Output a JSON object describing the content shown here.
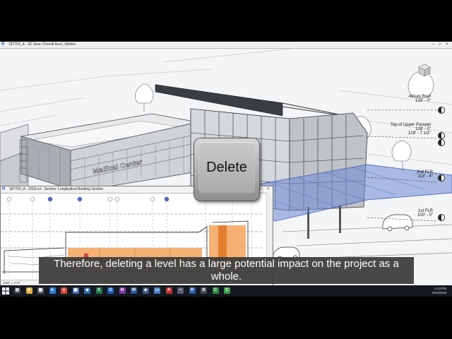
{
  "main_window": {
    "title": "187703_A - 3D View: Overall Asen_Hidden",
    "app_badge": "R",
    "controls": [
      "–",
      "□",
      "×"
    ]
  },
  "building": {
    "sign_text": "Medical Center"
  },
  "levels": [
    {
      "name": "Atrium Roof",
      "elev": "135' - 0\""
    },
    {
      "name": "Top of Upper Parapet",
      "elev": "128' - 0\"",
      "elev2": "128' - 7 1/2\""
    },
    {
      "name": "2nd FLR",
      "elev": "113' - 4\""
    },
    {
      "name": "1st FLR",
      "elev": "100' - 0\""
    }
  ],
  "section_window": {
    "title": "187703_A - 2019.rvt - Section: Longitudinal Building Section",
    "app_badge": "R",
    "controls": [
      "–",
      "□",
      "×"
    ],
    "scale": "1/16\" = 1'-0\""
  },
  "key_overlay": {
    "label": "Delete"
  },
  "caption": {
    "text": "Therefore, deleting a level has a large potential impact on the project as a whole."
  },
  "taskbar": {
    "time": "4:13 PM",
    "date": "2/16/2018",
    "apps": [
      {
        "name": "task-view",
        "color": "#3a3f4a",
        "glyph": "▤"
      },
      {
        "name": "file-explorer",
        "color": "#e0b040",
        "glyph": "■"
      },
      {
        "name": "calculator",
        "color": "#555b66",
        "glyph": "▦"
      },
      {
        "name": "edge",
        "color": "#2f7bd3",
        "glyph": "e"
      },
      {
        "name": "chrome",
        "color": "#d84b3a",
        "glyph": "●"
      },
      {
        "name": "store",
        "color": "#4a6fb0",
        "glyph": "▣"
      },
      {
        "name": "autodesk",
        "color": "#2d6aa8",
        "glyph": "◆"
      },
      {
        "name": "excel",
        "color": "#1f7a44",
        "glyph": "X"
      },
      {
        "name": "outlook",
        "color": "#1a5fb4",
        "glyph": "O"
      },
      {
        "name": "onenote",
        "color": "#7b3aa0",
        "glyph": "N"
      },
      {
        "name": "word",
        "color": "#2b5797",
        "glyph": "W"
      },
      {
        "name": "settings",
        "color": "#3a5a8a",
        "glyph": "◈"
      },
      {
        "name": "navisworks",
        "color": "#4a7fc0",
        "glyph": "▭"
      },
      {
        "name": "acrobat",
        "color": "#c0302a",
        "glyph": "A"
      },
      {
        "name": "people",
        "color": "#5a6070",
        "glyph": "•"
      },
      {
        "name": "revit",
        "color": "#2a5ca8",
        "glyph": "R"
      },
      {
        "name": "gear",
        "color": "#444a55",
        "glyph": "⚙"
      },
      {
        "name": "camtasia",
        "color": "#2f8a3e",
        "glyph": "C"
      },
      {
        "name": "camtasia-recorder",
        "color": "#3c9c4a",
        "glyph": "C"
      }
    ]
  }
}
